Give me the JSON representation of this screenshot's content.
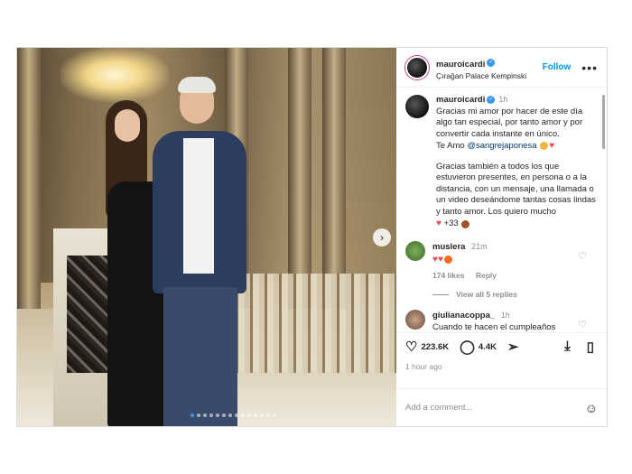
{
  "post": {
    "author": "mauroicardi",
    "location": "Çırağan Palace Kempinski",
    "follow_label": "Follow",
    "more_label": "•••"
  },
  "caption": {
    "username": "mauroicardi",
    "time": "1h",
    "para1": "Gracias mi amor por hacer de este día algo tan especial, por tanto amor y por convertir cada instante en único.",
    "te_amo": "Te Amo",
    "mention": "@sangrejaponesa",
    "para2": "Gracias también a todos los que estuvieron presentes, en persona o a la distancia, con un mensaje, una llamada o un video deseándome tantas cosas lindas y tanto amor. Los quiero mucho",
    "plus": "+33"
  },
  "comments": [
    {
      "username": "muslera",
      "time": "21m",
      "likes": "174 likes",
      "reply_label": "Reply",
      "view_replies": "View all 5 replies"
    },
    {
      "username": "giulianacoppa_",
      "time": "1h",
      "text": "Cuando te hacen el cumpleaños"
    }
  ],
  "actions": {
    "likes": "223.6K",
    "comments": "4.4K",
    "ago": "1 hour ago"
  },
  "add_comment": {
    "placeholder": "Add a comment..."
  },
  "icons": {
    "verified": "verified-badge-icon",
    "heart": "heart-icon",
    "comment": "comment-icon",
    "share": "share-icon",
    "download": "download-icon",
    "bookmark": "bookmark-icon",
    "emoji": "emoji-icon",
    "next": "chevron-right-icon"
  },
  "colors": {
    "accent": "#0095f6",
    "verified": "#3897f0",
    "heart": "#ed4956"
  }
}
